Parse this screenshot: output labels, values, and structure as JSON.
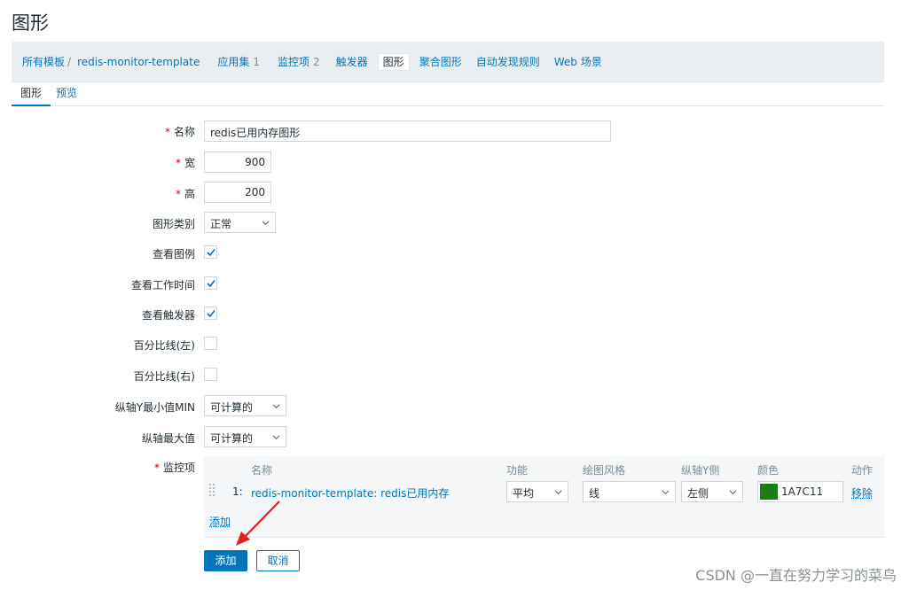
{
  "page": {
    "title": "图形"
  },
  "breadcrumb": {
    "all_templates": "所有模板",
    "separator": "/",
    "template": "redis-monitor-template",
    "applications": {
      "label": "应用集",
      "count": "1"
    },
    "items": {
      "label": "监控项",
      "count": "2"
    },
    "triggers": "触发器",
    "graphs": "图形",
    "screens": "聚合图形",
    "discovery": "自动发现规则",
    "web": "Web 场景"
  },
  "tabs": {
    "graph": "图形",
    "preview": "预览"
  },
  "form": {
    "name": {
      "label": "名称",
      "value": "redis已用内存图形"
    },
    "width": {
      "label": "宽",
      "value": "900"
    },
    "height": {
      "label": "高",
      "value": "200"
    },
    "graph_type": {
      "label": "图形类别",
      "value": "正常"
    },
    "show_legend": {
      "label": "查看图例",
      "checked": true
    },
    "show_working_time": {
      "label": "查看工作时间",
      "checked": true
    },
    "show_triggers": {
      "label": "查看触发器",
      "checked": true
    },
    "percentile_left": {
      "label": "百分比线(左)",
      "checked": false
    },
    "percentile_right": {
      "label": "百分比线(右)",
      "checked": false
    },
    "ymin": {
      "label": "纵轴Y最小值MIN",
      "value": "可计算的"
    },
    "ymax": {
      "label": "纵轴最大值",
      "value": "可计算的"
    },
    "items_label": "监控项",
    "required_mark": "*"
  },
  "items_table": {
    "headers": {
      "name": "名称",
      "function": "功能",
      "draw_style": "绘图风格",
      "y_axis": "纵轴Y侧",
      "color": "颜色",
      "action": "动作"
    },
    "rows": [
      {
        "index": "1:",
        "name": "redis-monitor-template: redis已用内存",
        "function": "平均",
        "draw_style": "线",
        "y_axis": "左侧",
        "color_hex": "1A7C11",
        "action": "移除"
      }
    ],
    "add_link": "添加"
  },
  "buttons": {
    "add": "添加",
    "cancel": "取消"
  },
  "watermark": "CSDN @一直在努力学习的菜鸟",
  "colors": {
    "accent": "#0275b8",
    "required": "#d40000",
    "swatch": "#1A7C11"
  }
}
